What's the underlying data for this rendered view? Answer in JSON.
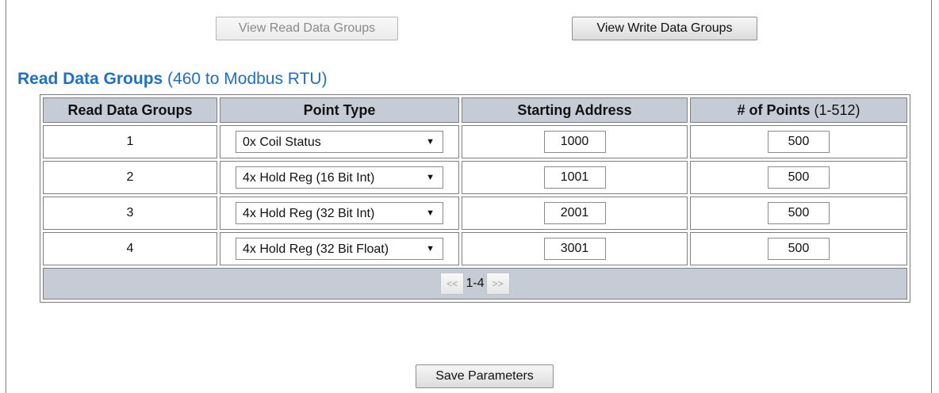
{
  "toolbar": {
    "view_read_label": "View Read Data Groups",
    "view_write_label": "View Write Data Groups"
  },
  "heading": {
    "bold": "Read Data Groups",
    "rest": " (460  to Modbus RTU)"
  },
  "table": {
    "headers": {
      "group": "Read Data Groups",
      "point_type": "Point Type",
      "starting_address": "Starting Address",
      "num_points": "# of Points",
      "num_points_range": " (1-512)"
    },
    "rows": [
      {
        "group": "1",
        "point_type": "0x Coil Status",
        "starting_address": "1000",
        "num_points": "500"
      },
      {
        "group": "2",
        "point_type": "4x Hold Reg (16 Bit Int)",
        "starting_address": "1001",
        "num_points": "500"
      },
      {
        "group": "3",
        "point_type": "4x Hold Reg (32 Bit Int)",
        "starting_address": "2001",
        "num_points": "500"
      },
      {
        "group": "4",
        "point_type": "4x Hold Reg (32 Bit Float)",
        "starting_address": "3001",
        "num_points": "500"
      }
    ]
  },
  "pager": {
    "prev": "<<",
    "label": "1-4",
    "next": ">>"
  },
  "save_label": "Save Parameters",
  "colors": {
    "accent": "#1f6fc6",
    "header_bg": "#c6ccd6"
  }
}
